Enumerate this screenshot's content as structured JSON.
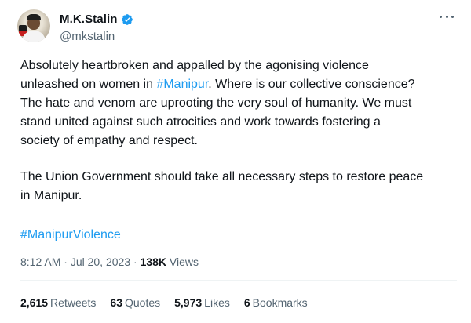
{
  "author": {
    "name": "M.K.Stalin",
    "handle": "@mkstalin"
  },
  "tweet": {
    "p1_line1_a": "Absolutely heartbroken and appalled by the agonising violence",
    "p1_line2_a": "unleashed on women in ",
    "hashtag_inline": "#Manipur",
    "p1_line2_b": ". Where is our collective conscience?",
    "p1_line3": "The hate and venom are uprooting the very soul of humanity. We must",
    "p1_line4": "stand united against such atrocities and work towards fostering a",
    "p1_line5": "society of empathy and respect.",
    "p2_line1": "The Union Government should take all necessary steps to restore peace",
    "p2_line2": "in Manipur.",
    "hashtag_final": "#ManipurViolence"
  },
  "meta": {
    "time": "8:12 AM",
    "separator1": " · ",
    "date": "Jul 20, 2023",
    "separator2": " · ",
    "views_count": "138K",
    "views_label": " Views"
  },
  "stats": {
    "retweets_count": "2,615",
    "retweets_label": "Retweets",
    "quotes_count": "63",
    "quotes_label": "Quotes",
    "likes_count": "5,973",
    "likes_label": "Likes",
    "bookmarks_count": "6",
    "bookmarks_label": "Bookmarks"
  },
  "colors": {
    "link": "#1d9bf0",
    "secondary_text": "#536471",
    "primary_text": "#0f1419",
    "verified": "#1d9bf0"
  },
  "icons": [
    "verified-badge-icon",
    "more-options-icon"
  ]
}
